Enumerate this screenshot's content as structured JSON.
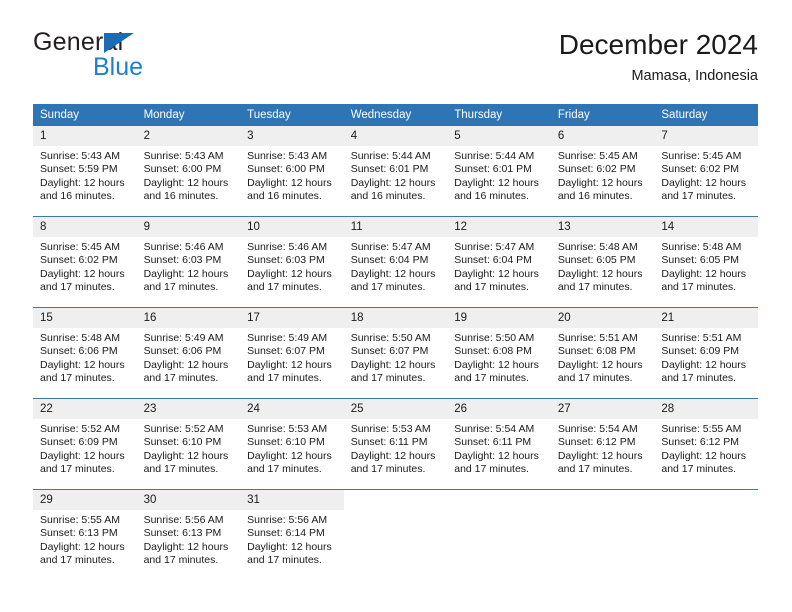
{
  "brand": {
    "name_part1": "General",
    "name_part2": "Blue",
    "triangle_color": "#1b6cb3",
    "blue_color": "#1b7fd4"
  },
  "header": {
    "title": "December 2024",
    "subtitle": "Mamasa, Indonesia"
  },
  "theme": {
    "header_blue": "#2e75b6",
    "daynum_gray": "#efefef",
    "separator": "#3a78b0"
  },
  "weekdays": [
    "Sunday",
    "Monday",
    "Tuesday",
    "Wednesday",
    "Thursday",
    "Friday",
    "Saturday"
  ],
  "weeks": [
    [
      {
        "day": "1",
        "sunrise": "Sunrise: 5:43 AM",
        "sunset": "Sunset: 5:59 PM",
        "daylight_line1": "Daylight: 12 hours",
        "daylight_line2": "and 16 minutes."
      },
      {
        "day": "2",
        "sunrise": "Sunrise: 5:43 AM",
        "sunset": "Sunset: 6:00 PM",
        "daylight_line1": "Daylight: 12 hours",
        "daylight_line2": "and 16 minutes."
      },
      {
        "day": "3",
        "sunrise": "Sunrise: 5:43 AM",
        "sunset": "Sunset: 6:00 PM",
        "daylight_line1": "Daylight: 12 hours",
        "daylight_line2": "and 16 minutes."
      },
      {
        "day": "4",
        "sunrise": "Sunrise: 5:44 AM",
        "sunset": "Sunset: 6:01 PM",
        "daylight_line1": "Daylight: 12 hours",
        "daylight_line2": "and 16 minutes."
      },
      {
        "day": "5",
        "sunrise": "Sunrise: 5:44 AM",
        "sunset": "Sunset: 6:01 PM",
        "daylight_line1": "Daylight: 12 hours",
        "daylight_line2": "and 16 minutes."
      },
      {
        "day": "6",
        "sunrise": "Sunrise: 5:45 AM",
        "sunset": "Sunset: 6:02 PM",
        "daylight_line1": "Daylight: 12 hours",
        "daylight_line2": "and 16 minutes."
      },
      {
        "day": "7",
        "sunrise": "Sunrise: 5:45 AM",
        "sunset": "Sunset: 6:02 PM",
        "daylight_line1": "Daylight: 12 hours",
        "daylight_line2": "and 17 minutes."
      }
    ],
    [
      {
        "day": "8",
        "sunrise": "Sunrise: 5:45 AM",
        "sunset": "Sunset: 6:02 PM",
        "daylight_line1": "Daylight: 12 hours",
        "daylight_line2": "and 17 minutes."
      },
      {
        "day": "9",
        "sunrise": "Sunrise: 5:46 AM",
        "sunset": "Sunset: 6:03 PM",
        "daylight_line1": "Daylight: 12 hours",
        "daylight_line2": "and 17 minutes."
      },
      {
        "day": "10",
        "sunrise": "Sunrise: 5:46 AM",
        "sunset": "Sunset: 6:03 PM",
        "daylight_line1": "Daylight: 12 hours",
        "daylight_line2": "and 17 minutes."
      },
      {
        "day": "11",
        "sunrise": "Sunrise: 5:47 AM",
        "sunset": "Sunset: 6:04 PM",
        "daylight_line1": "Daylight: 12 hours",
        "daylight_line2": "and 17 minutes."
      },
      {
        "day": "12",
        "sunrise": "Sunrise: 5:47 AM",
        "sunset": "Sunset: 6:04 PM",
        "daylight_line1": "Daylight: 12 hours",
        "daylight_line2": "and 17 minutes."
      },
      {
        "day": "13",
        "sunrise": "Sunrise: 5:48 AM",
        "sunset": "Sunset: 6:05 PM",
        "daylight_line1": "Daylight: 12 hours",
        "daylight_line2": "and 17 minutes."
      },
      {
        "day": "14",
        "sunrise": "Sunrise: 5:48 AM",
        "sunset": "Sunset: 6:05 PM",
        "daylight_line1": "Daylight: 12 hours",
        "daylight_line2": "and 17 minutes."
      }
    ],
    [
      {
        "day": "15",
        "sunrise": "Sunrise: 5:48 AM",
        "sunset": "Sunset: 6:06 PM",
        "daylight_line1": "Daylight: 12 hours",
        "daylight_line2": "and 17 minutes."
      },
      {
        "day": "16",
        "sunrise": "Sunrise: 5:49 AM",
        "sunset": "Sunset: 6:06 PM",
        "daylight_line1": "Daylight: 12 hours",
        "daylight_line2": "and 17 minutes."
      },
      {
        "day": "17",
        "sunrise": "Sunrise: 5:49 AM",
        "sunset": "Sunset: 6:07 PM",
        "daylight_line1": "Daylight: 12 hours",
        "daylight_line2": "and 17 minutes."
      },
      {
        "day": "18",
        "sunrise": "Sunrise: 5:50 AM",
        "sunset": "Sunset: 6:07 PM",
        "daylight_line1": "Daylight: 12 hours",
        "daylight_line2": "and 17 minutes."
      },
      {
        "day": "19",
        "sunrise": "Sunrise: 5:50 AM",
        "sunset": "Sunset: 6:08 PM",
        "daylight_line1": "Daylight: 12 hours",
        "daylight_line2": "and 17 minutes."
      },
      {
        "day": "20",
        "sunrise": "Sunrise: 5:51 AM",
        "sunset": "Sunset: 6:08 PM",
        "daylight_line1": "Daylight: 12 hours",
        "daylight_line2": "and 17 minutes."
      },
      {
        "day": "21",
        "sunrise": "Sunrise: 5:51 AM",
        "sunset": "Sunset: 6:09 PM",
        "daylight_line1": "Daylight: 12 hours",
        "daylight_line2": "and 17 minutes."
      }
    ],
    [
      {
        "day": "22",
        "sunrise": "Sunrise: 5:52 AM",
        "sunset": "Sunset: 6:09 PM",
        "daylight_line1": "Daylight: 12 hours",
        "daylight_line2": "and 17 minutes."
      },
      {
        "day": "23",
        "sunrise": "Sunrise: 5:52 AM",
        "sunset": "Sunset: 6:10 PM",
        "daylight_line1": "Daylight: 12 hours",
        "daylight_line2": "and 17 minutes."
      },
      {
        "day": "24",
        "sunrise": "Sunrise: 5:53 AM",
        "sunset": "Sunset: 6:10 PM",
        "daylight_line1": "Daylight: 12 hours",
        "daylight_line2": "and 17 minutes."
      },
      {
        "day": "25",
        "sunrise": "Sunrise: 5:53 AM",
        "sunset": "Sunset: 6:11 PM",
        "daylight_line1": "Daylight: 12 hours",
        "daylight_line2": "and 17 minutes."
      },
      {
        "day": "26",
        "sunrise": "Sunrise: 5:54 AM",
        "sunset": "Sunset: 6:11 PM",
        "daylight_line1": "Daylight: 12 hours",
        "daylight_line2": "and 17 minutes."
      },
      {
        "day": "27",
        "sunrise": "Sunrise: 5:54 AM",
        "sunset": "Sunset: 6:12 PM",
        "daylight_line1": "Daylight: 12 hours",
        "daylight_line2": "and 17 minutes."
      },
      {
        "day": "28",
        "sunrise": "Sunrise: 5:55 AM",
        "sunset": "Sunset: 6:12 PM",
        "daylight_line1": "Daylight: 12 hours",
        "daylight_line2": "and 17 minutes."
      }
    ],
    [
      {
        "day": "29",
        "sunrise": "Sunrise: 5:55 AM",
        "sunset": "Sunset: 6:13 PM",
        "daylight_line1": "Daylight: 12 hours",
        "daylight_line2": "and 17 minutes."
      },
      {
        "day": "30",
        "sunrise": "Sunrise: 5:56 AM",
        "sunset": "Sunset: 6:13 PM",
        "daylight_line1": "Daylight: 12 hours",
        "daylight_line2": "and 17 minutes."
      },
      {
        "day": "31",
        "sunrise": "Sunrise: 5:56 AM",
        "sunset": "Sunset: 6:14 PM",
        "daylight_line1": "Daylight: 12 hours",
        "daylight_line2": "and 17 minutes."
      },
      {
        "day": "",
        "sunrise": "",
        "sunset": "",
        "daylight_line1": "",
        "daylight_line2": ""
      },
      {
        "day": "",
        "sunrise": "",
        "sunset": "",
        "daylight_line1": "",
        "daylight_line2": ""
      },
      {
        "day": "",
        "sunrise": "",
        "sunset": "",
        "daylight_line1": "",
        "daylight_line2": ""
      },
      {
        "day": "",
        "sunrise": "",
        "sunset": "",
        "daylight_line1": "",
        "daylight_line2": ""
      }
    ]
  ]
}
